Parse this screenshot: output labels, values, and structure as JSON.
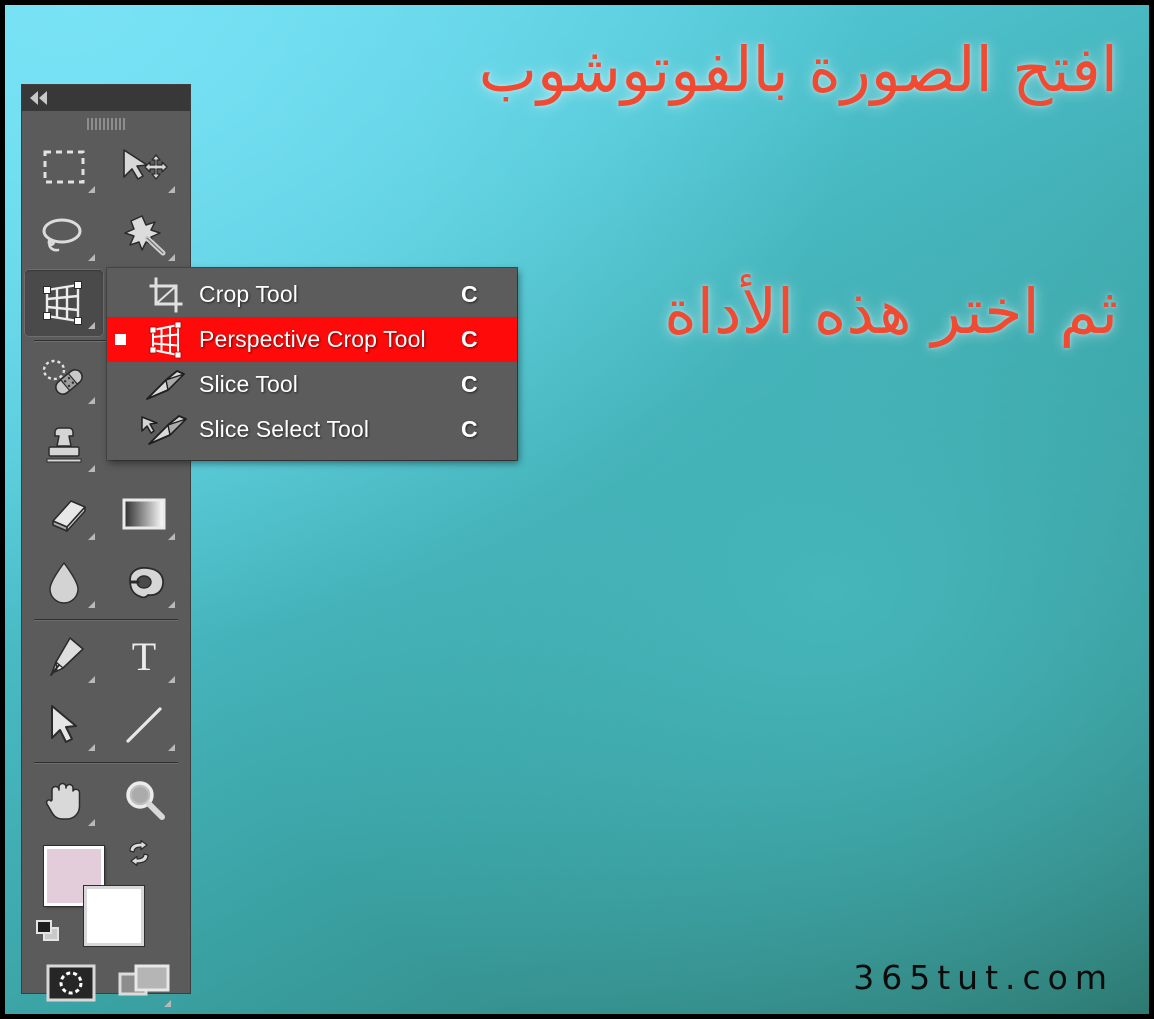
{
  "canvas": {
    "gradient_from": "#67dcf2",
    "gradient_to": "#2e7a72",
    "border_color": "#000000"
  },
  "captions": {
    "top": "افتح الصورة بالفوتوشوب",
    "second": "ثم اختر هذه الأداة",
    "color": "#f04a33"
  },
  "watermark": {
    "text": "365tut.com",
    "color": "#0b0b0b"
  },
  "toolbar": {
    "collapse_label": "collapse-panel",
    "grip_label": "panel-grip",
    "background": "#5b5b5b",
    "header_background": "#383838",
    "groups": [
      {
        "tools": [
          {
            "name": "rectangular-marquee-tool",
            "has_flyout": true,
            "active": false
          },
          {
            "name": "move-tool",
            "has_flyout": true,
            "active": false
          },
          {
            "name": "lasso-tool",
            "has_flyout": true,
            "active": false
          },
          {
            "name": "magic-wand-tool",
            "has_flyout": true,
            "active": false
          },
          {
            "name": "perspective-crop-tool",
            "has_flyout": true,
            "active": true
          },
          {
            "name": "eyedropper-tool",
            "has_flyout": true,
            "active": false
          }
        ]
      },
      {
        "tools": [
          {
            "name": "spot-healing-brush-tool",
            "has_flyout": true,
            "active": false
          },
          {
            "name": "brush-tool",
            "has_flyout": true,
            "active": false
          },
          {
            "name": "clone-stamp-tool",
            "has_flyout": true,
            "active": false
          },
          {
            "name": "history-brush-tool",
            "has_flyout": true,
            "active": false
          },
          {
            "name": "eraser-tool",
            "has_flyout": true,
            "active": false
          },
          {
            "name": "gradient-tool",
            "has_flyout": true,
            "active": false
          },
          {
            "name": "blur-tool",
            "has_flyout": true,
            "active": false
          },
          {
            "name": "dodge-tool",
            "has_flyout": true,
            "active": false
          }
        ]
      },
      {
        "tools": [
          {
            "name": "pen-tool",
            "has_flyout": true,
            "active": false
          },
          {
            "name": "horizontal-type-tool",
            "has_flyout": true,
            "active": false
          },
          {
            "name": "path-selection-tool",
            "has_flyout": true,
            "active": false
          },
          {
            "name": "line-tool",
            "has_flyout": true,
            "active": false
          }
        ]
      },
      {
        "tools": [
          {
            "name": "hand-tool",
            "has_flyout": true,
            "active": false
          },
          {
            "name": "zoom-tool",
            "has_flyout": false,
            "active": false
          }
        ]
      }
    ],
    "colors": {
      "foreground": "#e3cddb",
      "background": "#ffffff",
      "swap_label": "swap-foreground-background",
      "default_label": "default-foreground-background"
    },
    "modes": {
      "quick_mask_label": "edit-in-quick-mask-mode",
      "screen_mode_label": "change-screen-mode"
    }
  },
  "flyout_menu": {
    "background": "#5c5c5c",
    "highlight_color": "#ff0a0a",
    "items": [
      {
        "icon": "crop-tool-icon",
        "label": "Crop Tool",
        "shortcut": "C",
        "selected": false
      },
      {
        "icon": "perspective-crop-tool-icon",
        "label": "Perspective Crop Tool",
        "shortcut": "C",
        "selected": true
      },
      {
        "icon": "slice-tool-icon",
        "label": "Slice Tool",
        "shortcut": "C",
        "selected": false
      },
      {
        "icon": "slice-select-tool-icon",
        "label": "Slice Select Tool",
        "shortcut": "C",
        "selected": false
      }
    ]
  }
}
